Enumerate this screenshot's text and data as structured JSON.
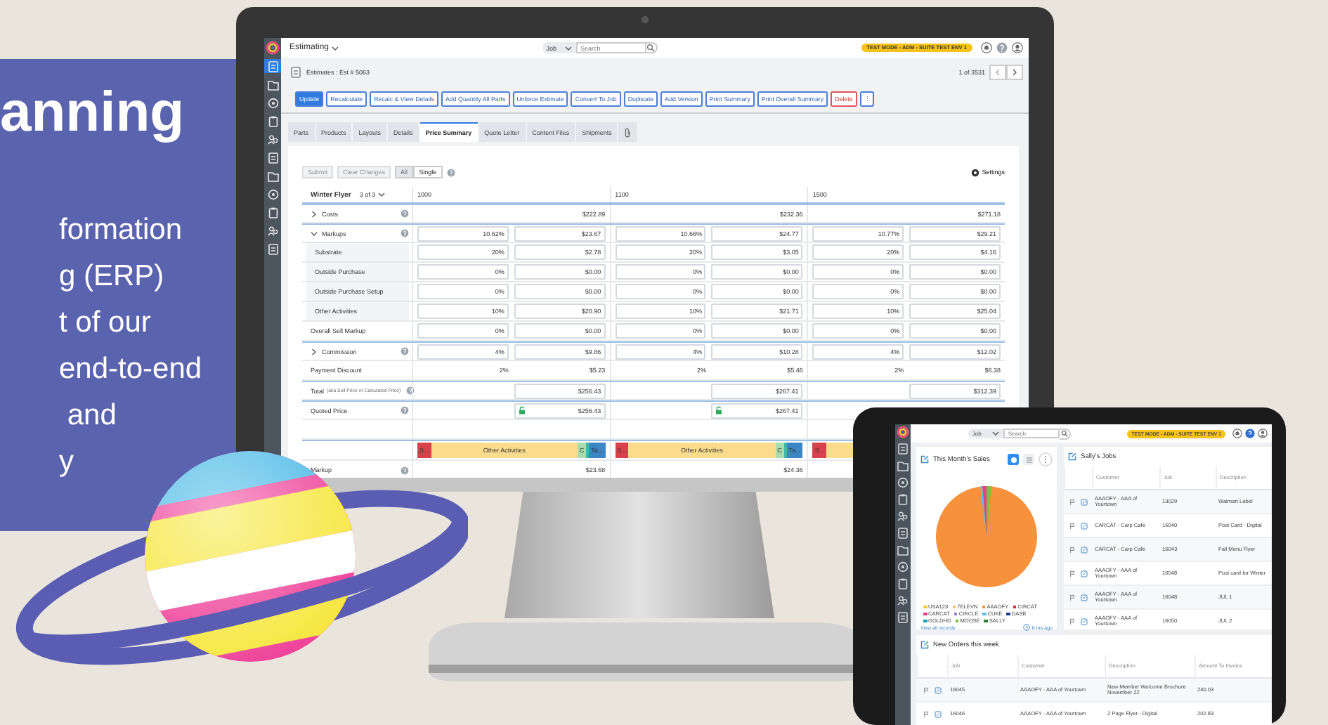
{
  "hero": {
    "heading": "anning",
    "body_lines": [
      "formation",
      "g (ERP)",
      "t of our",
      "end-to-end",
      " and",
      "y"
    ]
  },
  "monitor": {
    "app_title": "Estimating",
    "sidebar": [
      {
        "selected": true
      },
      {
        "selected": false
      },
      {
        "selected": false
      },
      {
        "selected": false
      },
      {
        "selected": false
      },
      {
        "selected": false
      },
      {
        "selected": false
      },
      {
        "selected": false
      },
      {
        "selected": false
      },
      {
        "selected": false
      },
      {
        "selected": false
      }
    ],
    "search": {
      "scope": "Job",
      "placeholder": "Search"
    },
    "mode_badge": "TEST MODE - ADM - SUITE TEST ENV 1",
    "breadcrumb": "Estimates : Est # 5063",
    "record_position": "1 of 3531",
    "actions": [
      {
        "label": "Update",
        "kind": "primary"
      },
      {
        "label": "Recalculate",
        "kind": "outline"
      },
      {
        "label": "Recalc & View Details",
        "kind": "outline"
      },
      {
        "label": "Add Quantity All Parts",
        "kind": "outline"
      },
      {
        "label": "Unforce Estimate",
        "kind": "outline"
      },
      {
        "label": "Convert To Job",
        "kind": "outline"
      },
      {
        "label": "Duplicate",
        "kind": "outline"
      },
      {
        "label": "Add Version",
        "kind": "outline"
      },
      {
        "label": "Print Summary",
        "kind": "outline"
      },
      {
        "label": "Print Overall Summary",
        "kind": "outline"
      },
      {
        "label": "Delete",
        "kind": "danger"
      },
      {
        "label": "⋮",
        "kind": "outline"
      }
    ],
    "tabs": [
      {
        "label": "Parts",
        "selected": false
      },
      {
        "label": "Products",
        "selected": false
      },
      {
        "label": "Layouts",
        "selected": false
      },
      {
        "label": "Details",
        "selected": false
      },
      {
        "label": "Price Summary",
        "selected": true
      },
      {
        "label": "Quote Letter",
        "selected": false
      },
      {
        "label": "Content Files",
        "selected": false
      },
      {
        "label": "Shipments",
        "selected": false
      }
    ],
    "toolbar": {
      "buttons": [
        {
          "label": "Submit",
          "disabled": true
        },
        {
          "label": "Clear Changes",
          "disabled": true
        }
      ],
      "modes": [
        {
          "label": "All",
          "selected": false
        },
        {
          "label": "Single",
          "selected": true
        }
      ],
      "settings": "Settings"
    },
    "table": {
      "title": "Winter Flyer",
      "version": "3 of 3",
      "columns": [
        "1000",
        "1100",
        "1500"
      ],
      "rows": [
        {
          "label": "Costs",
          "kind": "summary",
          "expanded": false,
          "help": true,
          "cells": [
            "$222.89",
            "$232.36",
            "$271.18"
          ]
        },
        {
          "label": "Markups",
          "kind": "inputs",
          "expanded": true,
          "help": true,
          "cells": [
            {
              "percent": "10.62%",
              "amount": "$23.67"
            },
            {
              "percent": "10.66%",
              "amount": "$24.77"
            },
            {
              "percent": "10.77%",
              "amount": "$29.21"
            }
          ],
          "children": [
            {
              "label": "Substrate",
              "kind": "inputs",
              "cells": [
                {
                  "percent": "20%",
                  "amount": "$2.78"
                },
                {
                  "percent": "20%",
                  "amount": "$3.05"
                },
                {
                  "percent": "20%",
                  "amount": "$4.16"
                }
              ]
            },
            {
              "label": "Outside Purchase",
              "kind": "inputs",
              "cells": [
                {
                  "percent": "0%",
                  "amount": "$0.00"
                },
                {
                  "percent": "0%",
                  "amount": "$0.00"
                },
                {
                  "percent": "0%",
                  "amount": "$0.00"
                }
              ]
            },
            {
              "label": "Outside Purchase Setup",
              "kind": "inputs",
              "cells": [
                {
                  "percent": "0%",
                  "amount": "$0.00"
                },
                {
                  "percent": "0%",
                  "amount": "$0.00"
                },
                {
                  "percent": "0%",
                  "amount": "$0.00"
                }
              ]
            },
            {
              "label": "Other Activities",
              "kind": "inputs",
              "cells": [
                {
                  "percent": "10%",
                  "amount": "$20.90"
                },
                {
                  "percent": "10%",
                  "amount": "$21.71"
                },
                {
                  "percent": "10%",
                  "amount": "$25.04"
                }
              ]
            }
          ]
        },
        {
          "label": "Overall Sell Markup",
          "kind": "inputs",
          "cells": [
            {
              "percent": "0%",
              "amount": "$0.00"
            },
            {
              "percent": "0%",
              "amount": "$0.00"
            },
            {
              "percent": "0%",
              "amount": "$0.00"
            }
          ]
        },
        {
          "label": "Commission",
          "kind": "inputs",
          "expanded": false,
          "help": true,
          "cells": [
            {
              "percent": "4%",
              "amount": "$9.86"
            },
            {
              "percent": "4%",
              "amount": "$10.28"
            },
            {
              "percent": "4%",
              "amount": "$12.02"
            }
          ]
        },
        {
          "label": "Payment Discount",
          "kind": "plain",
          "cells": [
            {
              "percent": "2%",
              "amount": "$5.23"
            },
            {
              "percent": "2%",
              "amount": "$5.46"
            },
            {
              "percent": "2%",
              "amount": "$6.38"
            }
          ]
        },
        {
          "label": "Total",
          "note": "(aka Sell Price or Calculated Price)",
          "kind": "amount",
          "help": true,
          "cells": [
            "$256.43",
            "$267.41",
            "$312.39"
          ]
        },
        {
          "label": "Quoted Price",
          "kind": "locked",
          "help": true,
          "cells": [
            "$256.43",
            "$267.41"
          ]
        },
        {
          "kind": "blank"
        },
        {
          "kind": "bars",
          "cells": [
            [
              {
                "label": "S...",
                "color": "#d8404c",
                "kind": "narrow"
              },
              {
                "label": "Other Activities",
                "color": "#fbdc8c",
                "kind": "wide"
              },
              {
                "label": "C",
                "color": "#a9dcae",
                "kind": "narrow"
              },
              {
                "color": "#3fb9a6",
                "kind": "thin"
              },
              {
                "label": "Ta...",
                "color": "#3d86c6",
                "kind": "narrow"
              }
            ],
            [
              {
                "label": "S...",
                "color": "#d8404c",
                "kind": "narrow"
              },
              {
                "label": "Other Activities",
                "color": "#fbdc8c",
                "kind": "wide"
              },
              {
                "label": "C",
                "color": "#a9dcae",
                "kind": "narrow"
              },
              {
                "color": "#3fb9a6",
                "kind": "thin"
              },
              {
                "label": "Ta...",
                "color": "#3d86c6",
                "kind": "narrow"
              }
            ],
            [
              {
                "label": "S...",
                "color": "#d8404c",
                "kind": "narrow"
              },
              {
                "color": "#fbdc8c",
                "kind": "wide"
              }
            ]
          ]
        },
        {
          "label": "Markup",
          "kind": "summary",
          "help": true,
          "cells": [
            "$23.68",
            "$24.36"
          ]
        }
      ]
    }
  },
  "tablet": {
    "search": {
      "scope": "Job",
      "placeholder": "Search"
    },
    "mode_badge": "TEST MODE - ADM - SUITE TEST ENV 1",
    "sales": {
      "title": "This Month's Sales",
      "views": [
        {
          "selected": true
        },
        {
          "selected": false
        }
      ],
      "legend": [
        {
          "label": "USA123",
          "color": "#f4d03f"
        },
        {
          "label": "7ELEVN",
          "color": "#f7c56b"
        },
        {
          "label": "AAAOFY",
          "color": "#f7913b"
        },
        {
          "label": "CIRCAT",
          "color": "#d9303b"
        },
        {
          "label": "CARCAT",
          "color": "#e83e8c"
        },
        {
          "label": "CIRCLE",
          "color": "#9b7fd4"
        },
        {
          "label": "CUKE",
          "color": "#5bc0eb"
        },
        {
          "label": "DASB",
          "color": "#1f3a93"
        },
        {
          "label": "GOLDHD",
          "color": "#17a2b8"
        },
        {
          "label": "MOOSE",
          "color": "#7ac143"
        },
        {
          "label": "SALLY",
          "color": "#2e7d32"
        }
      ],
      "link": "View all records",
      "updated": "6 hrs ago"
    },
    "jobs": {
      "title": "Sally's Jobs",
      "columns": [
        "Customer",
        "Job",
        "Description"
      ],
      "rows": [
        [
          "AAAOFY - AAA of Yourtown",
          "13029",
          "Walmart Label"
        ],
        [
          "CARCAT - Carp Café",
          "16040",
          "Post Card - Digital"
        ],
        [
          "CARCAT - Carp Café",
          "16043",
          "Fall Menu Flyer"
        ],
        [
          "AAAOFY - AAA of Yourtown",
          "16048",
          "Post card for Winter"
        ],
        [
          "AAAOFY - AAA of Yourtown",
          "16048",
          "JUL 1"
        ],
        [
          "AAAOFY - AAA of Yourtown",
          "16050",
          "JUL 2"
        ]
      ]
    },
    "orders": {
      "title": "New Orders this week",
      "columns": [
        "Job",
        "Customer",
        "Description",
        "Amount To Invoice"
      ],
      "rows": [
        [
          "16045",
          "AAAOFY - AAA of Yourtown",
          "New Member Welcome Brochure November 22",
          "240.03"
        ],
        [
          "16046",
          "AAAOFY - AAA of Yourtown",
          "2 Page Flyer - Digital",
          "202.83"
        ]
      ]
    }
  }
}
